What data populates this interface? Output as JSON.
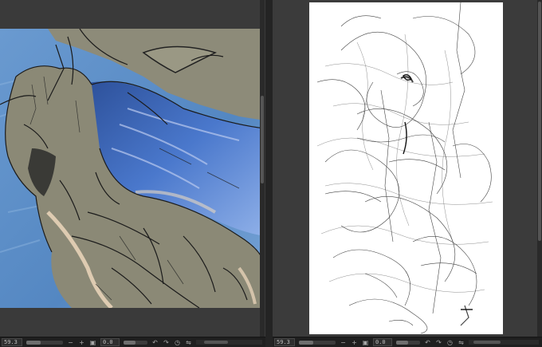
{
  "left_view": {
    "zoom": "59.3",
    "angle": "0.0",
    "zoom_slider_fraction": 0.4
  },
  "right_view": {
    "zoom": "59.3",
    "angle": "0.0",
    "zoom_slider_fraction": 0.4
  },
  "icons": {
    "zoom_out": "minus-icon",
    "zoom_in": "plus-icon",
    "fit": "fit-screen-icon",
    "rotate_left": "rotate-left-icon",
    "rotate_right": "rotate-right-icon",
    "reset_rotation": "reset-rotation-icon",
    "flip": "flip-horizontal-icon"
  },
  "colors": {
    "sky_blue": "#5b8fc8",
    "creature_grey": "#8c8a78",
    "wing_blue": "#3f6bc0",
    "paper": "#ffffff",
    "ui_dark": "#2d2d2d"
  }
}
